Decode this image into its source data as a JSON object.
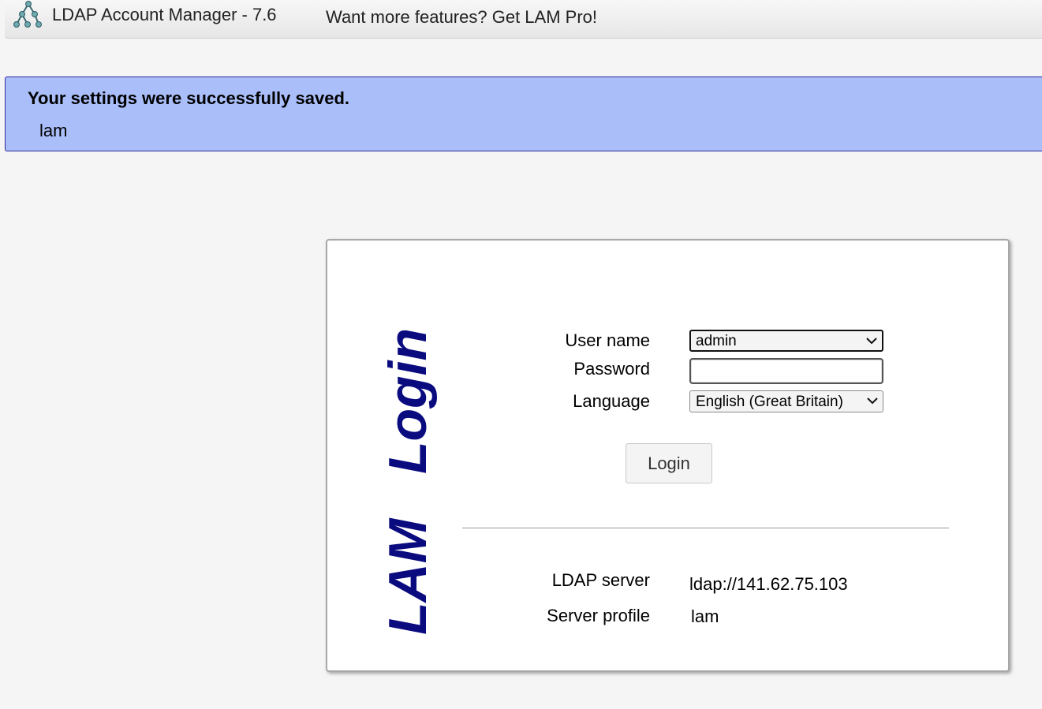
{
  "header": {
    "title": "LDAP Account Manager - 7.6",
    "promo_link": "Want more features? Get LAM Pro!"
  },
  "message": {
    "title": "Your settings were successfully saved.",
    "text": "lam",
    "background_color": "#aabffa",
    "border_color": "#2b2b9e"
  },
  "login": {
    "vertical_title": "LAM   Login",
    "title_color": "#0b0b80",
    "fields": {
      "user_label": "User name",
      "user_value": "admin",
      "password_label": "Password",
      "password_value": "",
      "language_label": "Language",
      "language_value": "English (Great Britain)"
    },
    "button_label": "Login",
    "info": {
      "server_label": "LDAP server",
      "server_value": "ldap://141.62.75.103",
      "profile_label": "Server profile",
      "profile_value": "lam"
    }
  },
  "icons": {
    "logo": "network-tree-icon",
    "dropdown": "chevron-down-icon"
  }
}
